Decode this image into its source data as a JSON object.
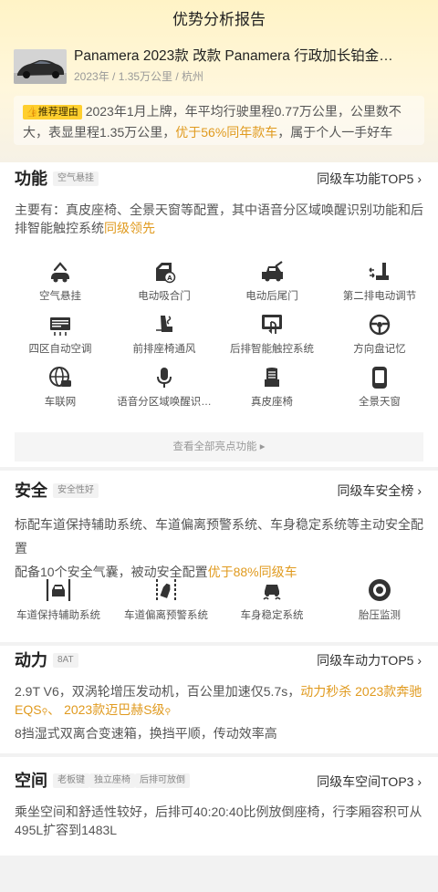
{
  "header": {
    "title": "优势分析报告",
    "car_name": "Panamera 2023款 改款 Panamera 行政加长铂金…",
    "car_meta": "2023年 / 1.35万公里 / 杭州",
    "reason_badge": "推荐理由",
    "reason_text_1": "2023年1月上牌，年平均行驶里程0.77万公里，公里数不大，表显里程1.35万公里，",
    "reason_highlight": "优于56%同年款车",
    "reason_text_2": "，属于个人一手好车"
  },
  "function": {
    "title": "功能",
    "tag": "空气悬挂",
    "link": "同级车功能TOP5 ›",
    "desc": "主要有：真皮座椅、全景天窗等配置，其中语音分区域唤醒识别功能和后排智能触控系统",
    "desc_highlight": "同级领先",
    "features": [
      {
        "label": "空气悬挂",
        "icon": "air-suspension-icon"
      },
      {
        "label": "电动吸合门",
        "icon": "soft-close-door-icon"
      },
      {
        "label": "电动后尾门",
        "icon": "power-tailgate-icon"
      },
      {
        "label": "第二排电动调节",
        "icon": "second-row-seat-icon"
      },
      {
        "label": "四区自动空调",
        "icon": "climate-control-icon"
      },
      {
        "label": "前排座椅通风",
        "icon": "seat-ventilation-icon"
      },
      {
        "label": "后排智能触控系统",
        "icon": "rear-touch-control-icon"
      },
      {
        "label": "方向盘记忆",
        "icon": "steering-wheel-icon"
      },
      {
        "label": "车联网",
        "icon": "connected-car-icon"
      },
      {
        "label": "语音分区域唤醒识…",
        "icon": "microphone-icon"
      },
      {
        "label": "真皮座椅",
        "icon": "leather-seat-icon"
      },
      {
        "label": "全景天窗",
        "icon": "panoramic-sunroof-icon"
      }
    ],
    "view_all": "查看全部亮点功能 ▸"
  },
  "safety": {
    "title": "安全",
    "tag": "安全性好",
    "link": "同级车安全榜 ›",
    "desc_1": "标配车道保持辅助系统、车道偏离预警系统、车身稳定系统等主动安全配置",
    "desc_2": "配备10个安全气囊，被动安全配置",
    "desc_2_highlight": "优于88%同级车",
    "features": [
      {
        "label": "车道保持辅助系统",
        "icon": "lane-keep-icon"
      },
      {
        "label": "车道偏离预警系统",
        "icon": "lane-departure-icon"
      },
      {
        "label": "车身稳定系统",
        "icon": "stability-control-icon"
      },
      {
        "label": "胎压监测",
        "icon": "tire-pressure-icon"
      }
    ]
  },
  "power": {
    "title": "动力",
    "tag": "8AT",
    "link": "同级车动力TOP5 ›",
    "desc_1": "2.9T V6，双涡轮增压发动机，百公里加速仅5.7s，",
    "desc_highlight": "动力秒杀",
    "compare_1": "2023款奔驰EQS",
    "separator": "、",
    "compare_2": "2023款迈巴赫S级",
    "desc_2": "8挡湿式双离合变速箱，换挡平顺，传动效率高"
  },
  "space": {
    "title": "空间",
    "tags": [
      "老板键",
      "独立座椅",
      "后排可放倒"
    ],
    "link": "同级车空间TOP3 ›",
    "desc": "乘坐空间和舒适性较好，后排可40:20:40比例放倒座椅，行李厢容积可从495L扩容到1483L"
  }
}
